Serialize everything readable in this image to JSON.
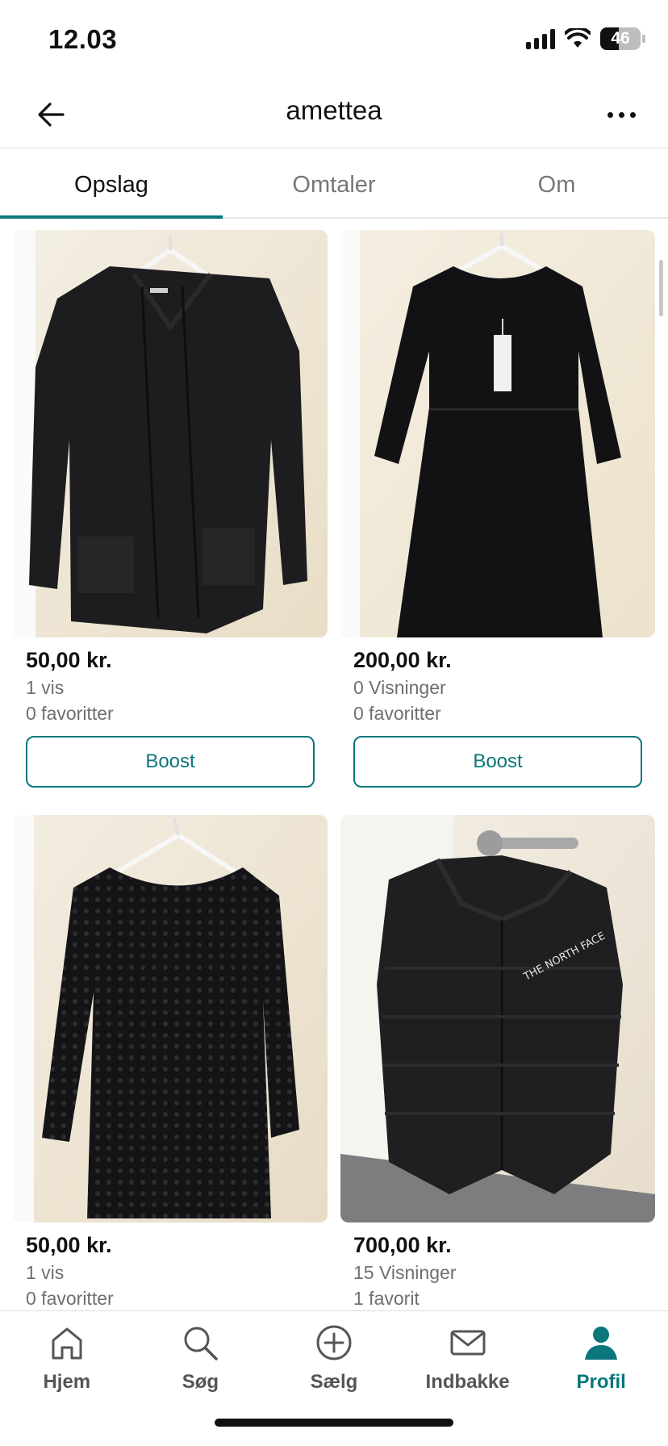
{
  "status_bar": {
    "time": "12.03",
    "battery_level": "46"
  },
  "header": {
    "title": "amettea",
    "back_icon": "arrow-left-icon",
    "more_icon": "more-horizontal-icon"
  },
  "tabs": [
    {
      "label": "Opslag",
      "active": true
    },
    {
      "label": "Omtaler",
      "active": false
    },
    {
      "label": "Om",
      "active": false
    }
  ],
  "listings": [
    {
      "image": "black cardigan on hanger",
      "price": "50,00 kr.",
      "views": "1 vis",
      "favorites": "0 favoritter",
      "button": "Boost"
    },
    {
      "image": "black velvet dress on hanger",
      "price": "200,00 kr.",
      "views": "0 Visninger",
      "favorites": "0 favoritter",
      "button": "Boost"
    },
    {
      "image": "black lace top on hanger",
      "price": "50,00 kr.",
      "views": "1 vis",
      "favorites": "0 favoritter"
    },
    {
      "image": "black puffer vest on door handle",
      "price": "700,00 kr.",
      "views": "15 Visninger",
      "favorites": "1 favorit"
    }
  ],
  "bottom_nav": [
    {
      "label": "Hjem",
      "icon": "home-icon",
      "active": false
    },
    {
      "label": "Søg",
      "icon": "search-icon",
      "active": false
    },
    {
      "label": "Sælg",
      "icon": "plus-circle-icon",
      "active": false
    },
    {
      "label": "Indbakke",
      "icon": "mail-icon",
      "active": false
    },
    {
      "label": "Profil",
      "icon": "profile-icon",
      "active": true
    }
  ],
  "colors": {
    "accent": "#09777c",
    "text": "#111111",
    "muted": "#6f6f6f",
    "divider": "#e4e4e4"
  }
}
